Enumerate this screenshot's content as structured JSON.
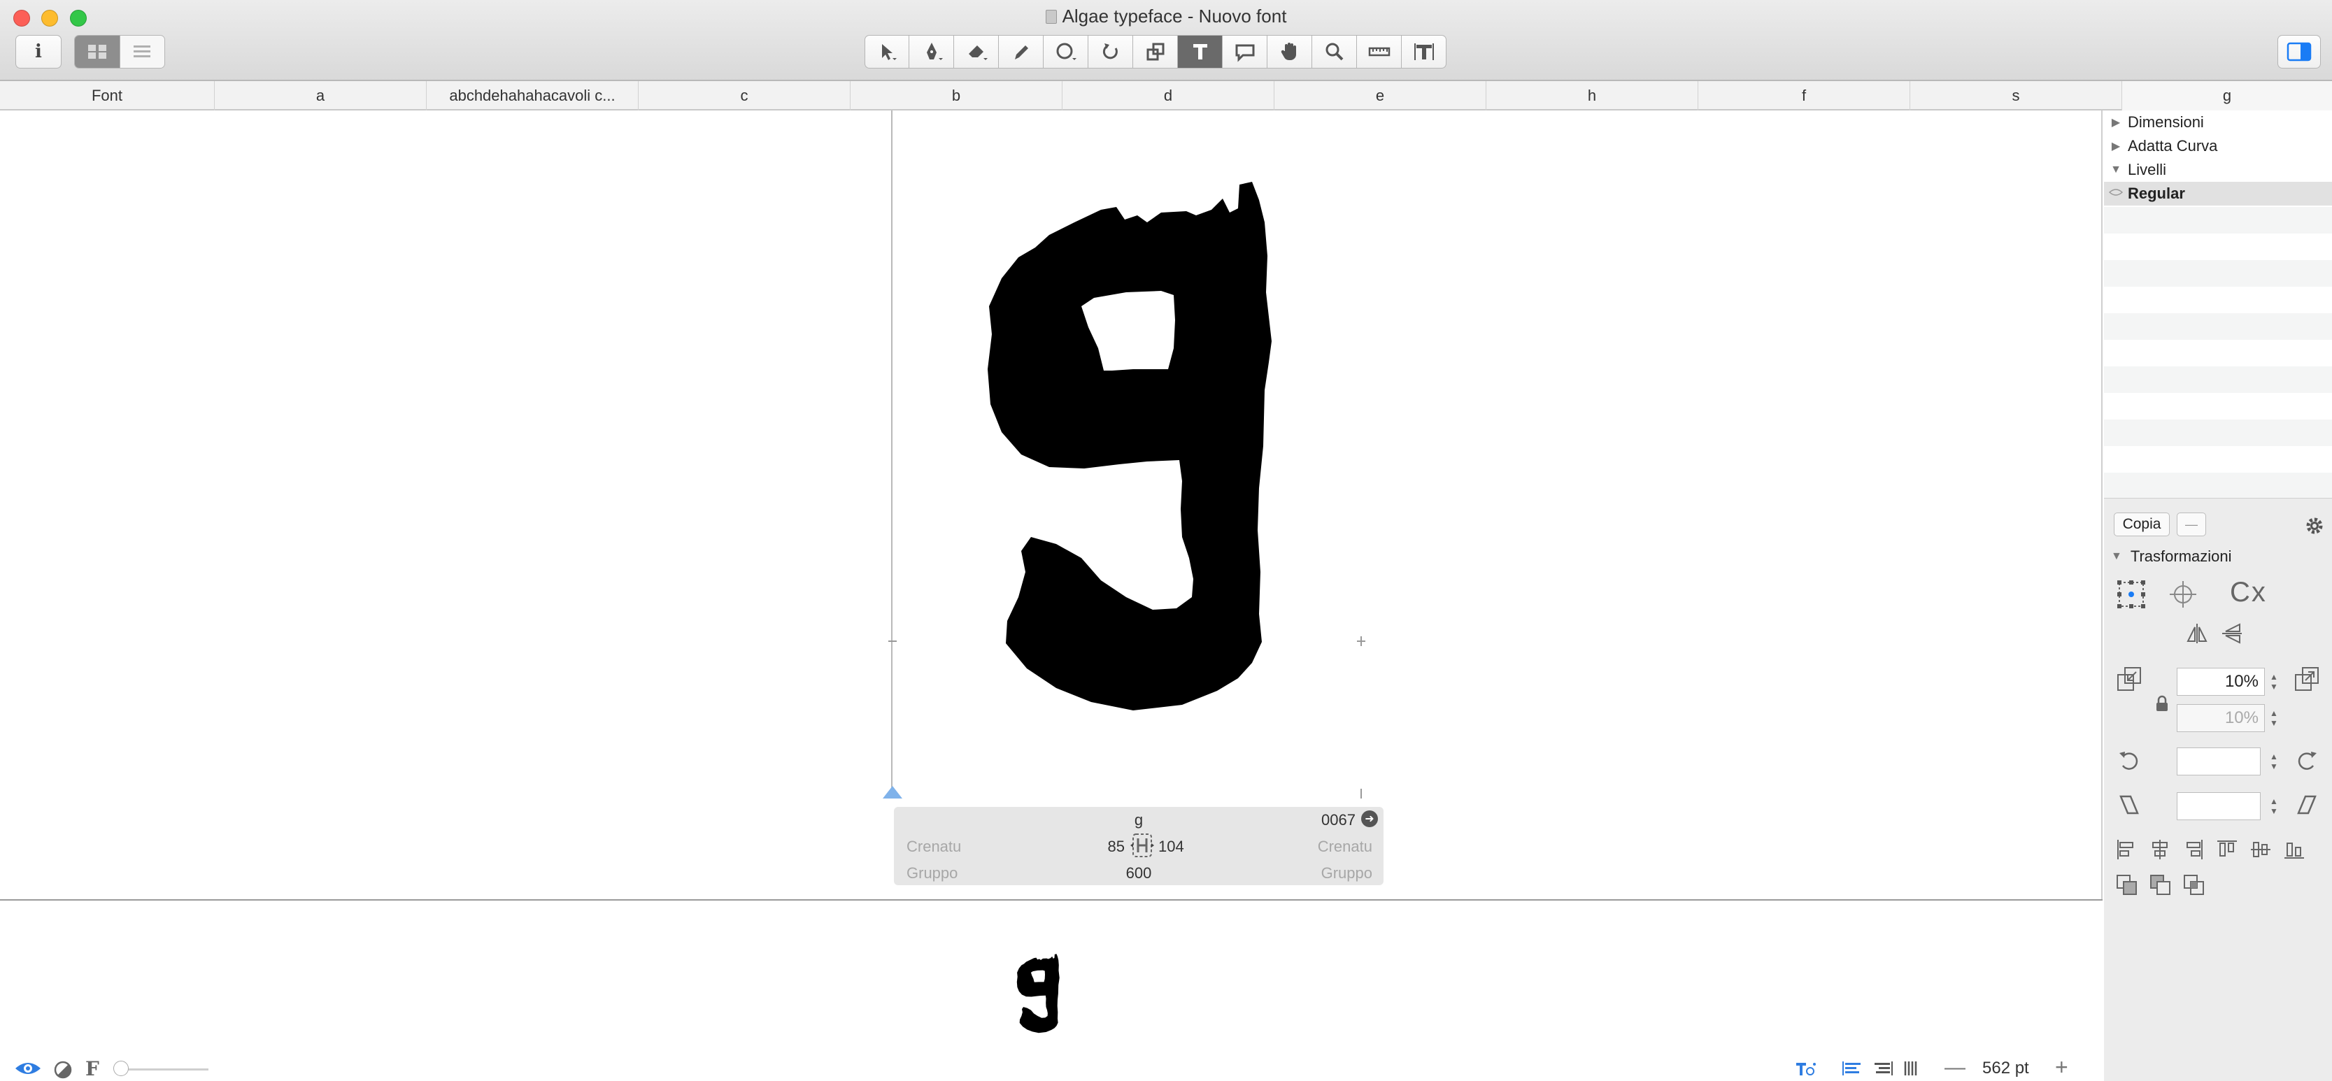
{
  "window": {
    "title": "Algae typeface - Nuovo font",
    "info_label": "i"
  },
  "toolbar": {
    "tools": [
      "select-icon",
      "pen-icon",
      "eraser-icon",
      "pencil-icon",
      "ellipse-icon",
      "rotate-icon",
      "scale-icon",
      "text-icon",
      "annotation-icon",
      "hand-icon",
      "zoom-icon",
      "measure-icon",
      "metrics-icon"
    ],
    "active_tool": "text-icon"
  },
  "columns": {
    "font": "Font",
    "c1": "a",
    "c2": "abchdehahahacavoli c...",
    "c3": "c",
    "c4": "b",
    "c5": "d",
    "c6": "e",
    "c7": "h",
    "c8": "f",
    "c9": "s",
    "c10": "g"
  },
  "glyph_info": {
    "name": "g",
    "unicode": "0067",
    "kerning_left_label": "Crenatu",
    "kerning_right_label": "Crenatu",
    "group_left_label": "Gruppo",
    "group_right_label": "Gruppo",
    "lsb": "85",
    "rsb": "104",
    "width": "600"
  },
  "sidebar": {
    "tree": [
      {
        "label": "Dimensioni",
        "expanded": false
      },
      {
        "label": "Adatta Curva",
        "expanded": false
      },
      {
        "label": "Livelli",
        "expanded": true
      }
    ],
    "layer": "Regular",
    "copy_button": "Copia",
    "dash_button": "—",
    "transform_title": "Trasformazioni",
    "scale_x": "10%",
    "scale_y": "10%",
    "rotate": "",
    "slant": "",
    "cx_label": "Cx"
  },
  "status": {
    "f_label": "F",
    "zoom": "562 pt",
    "zoom_minus": "—",
    "zoom_plus": "+"
  },
  "colors": {
    "accent": "#1a7cf5",
    "active_tool_bg": "#6a6a6a",
    "glyph_fill": "#000000"
  }
}
